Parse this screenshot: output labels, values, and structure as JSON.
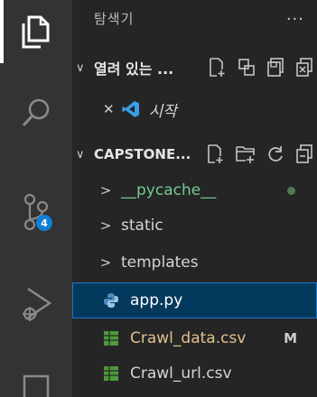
{
  "explorer": {
    "title": "탐색기",
    "more": "..."
  },
  "open_editors": {
    "header": "열려 있는 ...",
    "chevron": "∨",
    "items": [
      {
        "close": "✕",
        "label": "시작"
      }
    ]
  },
  "project": {
    "header": "CAPSTONE...",
    "chevron": "∨",
    "items": [
      {
        "caret": ">",
        "label": "__pycache__"
      },
      {
        "caret": ">",
        "label": "static"
      },
      {
        "caret": ">",
        "label": "templates"
      },
      {
        "label": "app.py"
      },
      {
        "label": "Crawl_data.csv",
        "status": "M"
      },
      {
        "label": "Crawl_url.csv"
      }
    ]
  },
  "activity": {
    "source_control_badge": "4"
  },
  "colors": {
    "accent": "#0e7fd4",
    "selected": "#04395e",
    "csv_icon": "#4e9a3a",
    "python_icon": "#4b8bbe"
  }
}
